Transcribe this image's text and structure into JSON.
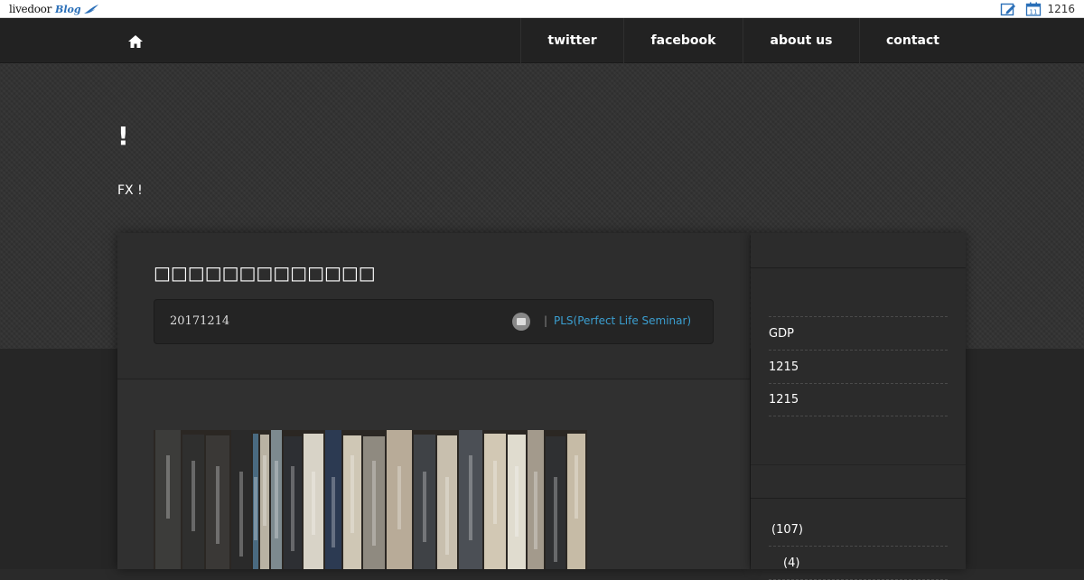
{
  "livedoor_bar": {
    "logo_text": "livedoor",
    "logo_blog": "Blog",
    "count": "1216"
  },
  "nav": {
    "links": [
      "twitter",
      "facebook",
      "about us",
      "contact"
    ]
  },
  "blog": {
    "title": "!",
    "description": "FX !"
  },
  "article": {
    "title": "□□□□□□□□□□□□□",
    "date": "20171214",
    "separator": "|",
    "category": "PLS(Perfect Life Seminar)"
  },
  "sidebar": {
    "recent": [
      "GDP",
      "1215",
      "1215"
    ],
    "categories": [
      "(107)",
      "(4)"
    ]
  }
}
